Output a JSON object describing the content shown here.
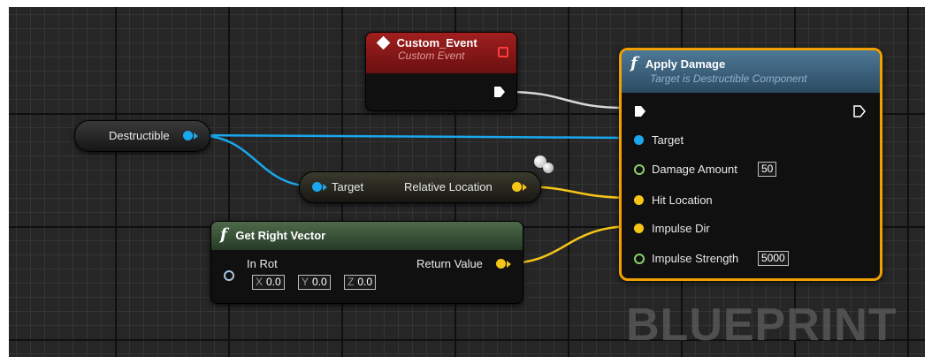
{
  "custom_event": {
    "title": "Custom_Event",
    "subtitle": "Custom Event"
  },
  "apply_damage": {
    "title": "Apply Damage",
    "subtitle": "Target is Destructible Component",
    "pins": {
      "target": "Target",
      "damage_amount": "Damage Amount",
      "damage_amount_value": "50",
      "hit_location": "Hit Location",
      "impulse_dir": "Impulse Dir",
      "impulse_strength": "Impulse Strength",
      "impulse_strength_value": "5000"
    }
  },
  "destructible": {
    "label": "Destructible"
  },
  "relative_location": {
    "input_label": "Target",
    "output_label": "Relative Location"
  },
  "get_right_vector": {
    "title": "Get Right Vector",
    "in_label": "In Rot",
    "x_label": "X",
    "x_value": "0.0",
    "y_label": "Y",
    "y_value": "0.0",
    "z_label": "Z",
    "z_value": "0.0",
    "return_label": "Return Value"
  },
  "watermark": "BLUEPRINT",
  "colors": {
    "object_pin": "#1aa7ec",
    "vector_pin": "#f5c518",
    "float_pin": "#8bd16a",
    "event_header": "#8a1c1c",
    "function_header": "#3c5f7a",
    "highlight": "#f0a000"
  }
}
